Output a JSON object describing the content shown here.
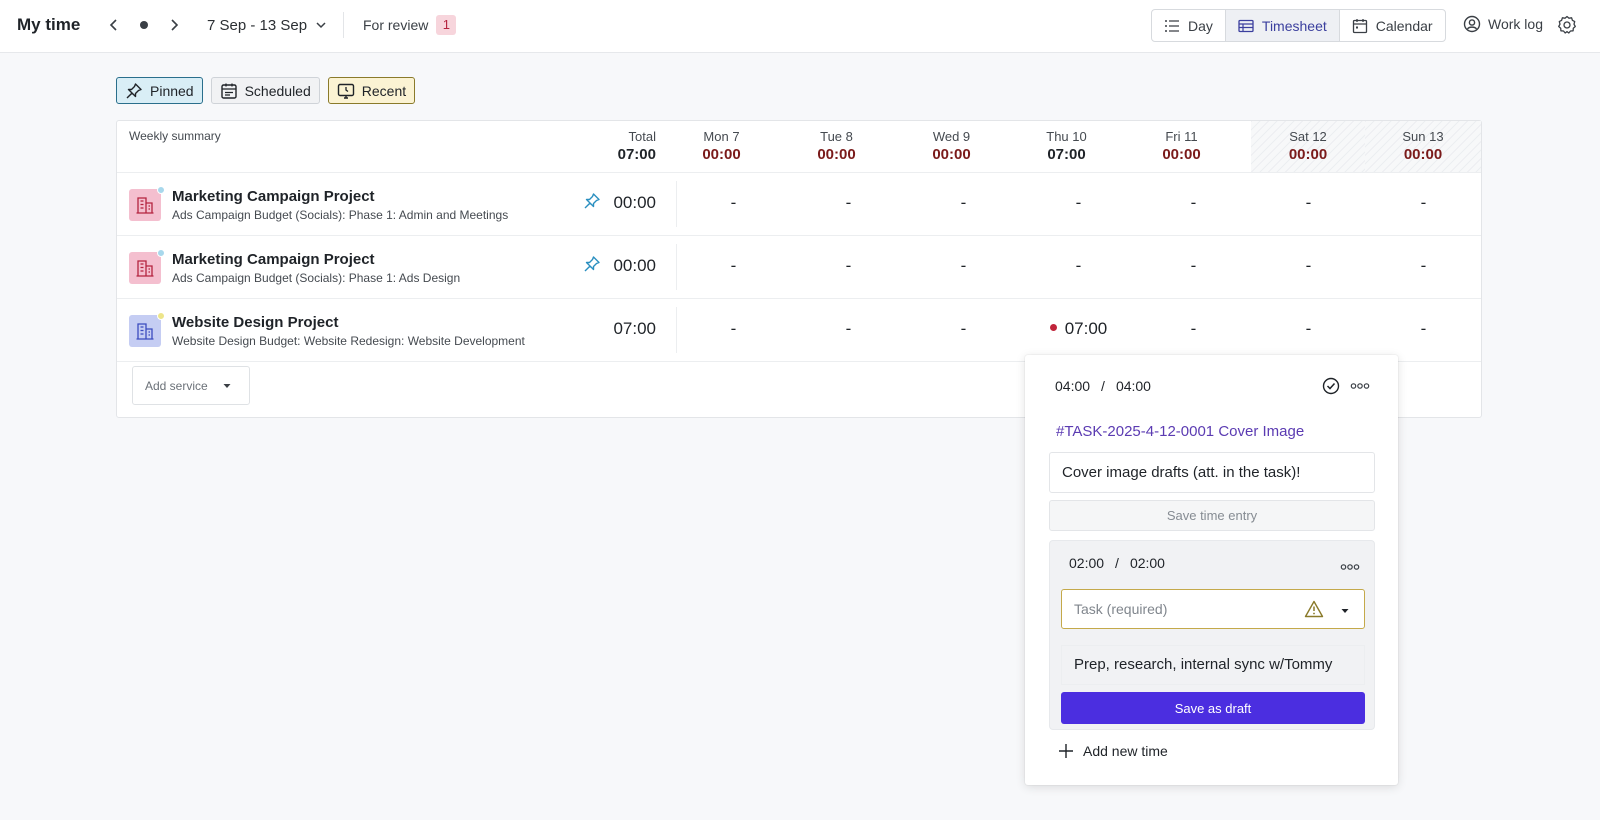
{
  "header": {
    "title": "My time",
    "date_range": "7 Sep - 13 Sep",
    "for_review_label": "For review",
    "for_review_count": "1",
    "views": [
      {
        "label": "Day",
        "icon": "list-icon",
        "active": false
      },
      {
        "label": "Timesheet",
        "icon": "table-icon",
        "active": true
      },
      {
        "label": "Calendar",
        "icon": "calendar-icon",
        "active": false
      }
    ],
    "work_log_label": "Work log"
  },
  "filters": [
    {
      "label": "Pinned",
      "icon": "pin-icon"
    },
    {
      "label": "Scheduled",
      "icon": "schedule-icon"
    },
    {
      "label": "Recent",
      "icon": "recent-icon"
    }
  ],
  "summary": {
    "label": "Weekly summary",
    "total": {
      "label": "Total",
      "value": "07:00"
    },
    "days": [
      {
        "label": "Mon 7",
        "value": "00:00",
        "weekend": false
      },
      {
        "label": "Tue 8",
        "value": "00:00",
        "weekend": false
      },
      {
        "label": "Wed 9",
        "value": "00:00",
        "weekend": false
      },
      {
        "label": "Thu 10",
        "value": "07:00",
        "weekend": false
      },
      {
        "label": "Fri 11",
        "value": "00:00",
        "weekend": false
      },
      {
        "label": "Sat 12",
        "value": "00:00",
        "weekend": true
      },
      {
        "label": "Sun 13",
        "value": "00:00",
        "weekend": true
      }
    ]
  },
  "rows": [
    {
      "project": "Marketing Campaign Project",
      "service": "Ads Campaign Budget (Socials): Phase 1: Admin and Meetings",
      "total": "00:00",
      "pinned": true,
      "icon_color": "#f4bfcf",
      "dot_color": "#a8d8ec",
      "cells": [
        "-",
        "-",
        "-",
        "-",
        "-",
        "-",
        "-"
      ]
    },
    {
      "project": "Marketing Campaign Project",
      "service": "Ads Campaign Budget (Socials): Phase 1: Ads Design",
      "total": "00:00",
      "pinned": true,
      "icon_color": "#f4bfcf",
      "dot_color": "#a8d8ec",
      "cells": [
        "-",
        "-",
        "-",
        "-",
        "-",
        "-",
        "-"
      ]
    },
    {
      "project": "Website Design Project",
      "service": "Website Design Budget: Website Redesign: Website Development",
      "total": "07:00",
      "pinned": false,
      "icon_color": "#c5cdf3",
      "dot_color": "#ede58a",
      "cells": [
        "-",
        "-",
        "-",
        "07:00",
        "-",
        "-",
        "-"
      ]
    }
  ],
  "add_service_label": "Add service",
  "popover": {
    "entry1": {
      "time": "04:00",
      "separator": "/",
      "billable": "04:00",
      "task_link": "#TASK-2025-4-12-0001 Cover Image",
      "note": "Cover image drafts (att. in the task)!",
      "save_label": "Save time entry"
    },
    "entry2": {
      "time": "02:00",
      "separator": "/",
      "billable": "02:00",
      "task_placeholder": "Task (required)",
      "note": "Prep, research, internal sync w/Tommy",
      "save_label": "Save as draft"
    },
    "add_new_time_label": "Add new time"
  },
  "colors": {
    "accent": "#4b2ee0",
    "task_link": "#5b3bb2",
    "day_total": "#7a1a1a",
    "review_badge_bg": "#f7d5dc",
    "pinned_chip_bg": "#d9eef6",
    "recent_chip_bg": "#fbf3d3",
    "entry_dot": "#c0243a"
  }
}
